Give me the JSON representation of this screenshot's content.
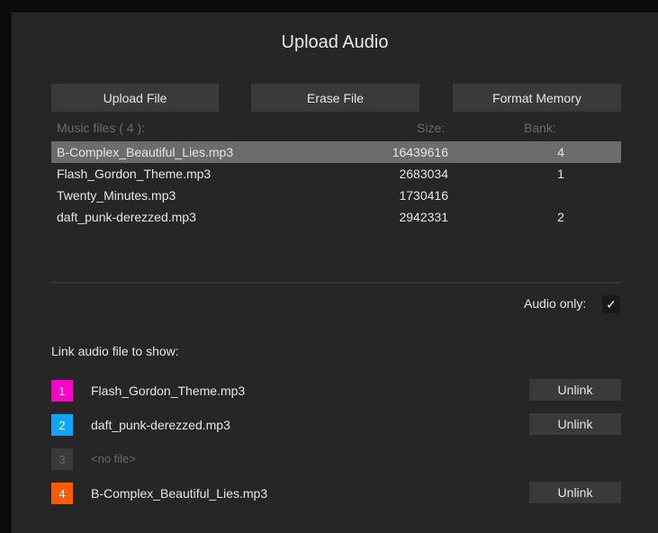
{
  "dialog": {
    "title": "Upload Audio"
  },
  "toolbar": {
    "upload_label": "Upload File",
    "erase_label": "Erase File",
    "format_label": "Format Memory"
  },
  "file_list": {
    "header_name": "Music files ( 4 ):",
    "header_size": "Size:",
    "header_bank": "Bank:",
    "rows": [
      {
        "name": "B-Complex_Beautiful_Lies.mp3",
        "size": "16439616",
        "bank": "4",
        "selected": true
      },
      {
        "name": "Flash_Gordon_Theme.mp3",
        "size": "2683034",
        "bank": "1",
        "selected": false
      },
      {
        "name": "Twenty_Minutes.mp3",
        "size": "1730416",
        "bank": "",
        "selected": false
      },
      {
        "name": "daft_punk-derezzed.mp3",
        "size": "2942331",
        "bank": "2",
        "selected": false
      }
    ]
  },
  "audio_only": {
    "label": "Audio only:",
    "checked": true,
    "check_glyph": "✓"
  },
  "link_section": {
    "title": "Link audio file to show:",
    "unlink_label": "Unlink",
    "slots": [
      {
        "number": "1",
        "file": "Flash_Gordon_Theme.mp3",
        "color": "#ff00c8"
      },
      {
        "number": "2",
        "file": "daft_punk-derezzed.mp3",
        "color": "#0aa6ff"
      },
      {
        "number": "3",
        "file": "<no file>",
        "color": "#3a3a3a"
      },
      {
        "number": "4",
        "file": "B-Complex_Beautiful_Lies.mp3",
        "color": "#ff5a00"
      }
    ]
  }
}
